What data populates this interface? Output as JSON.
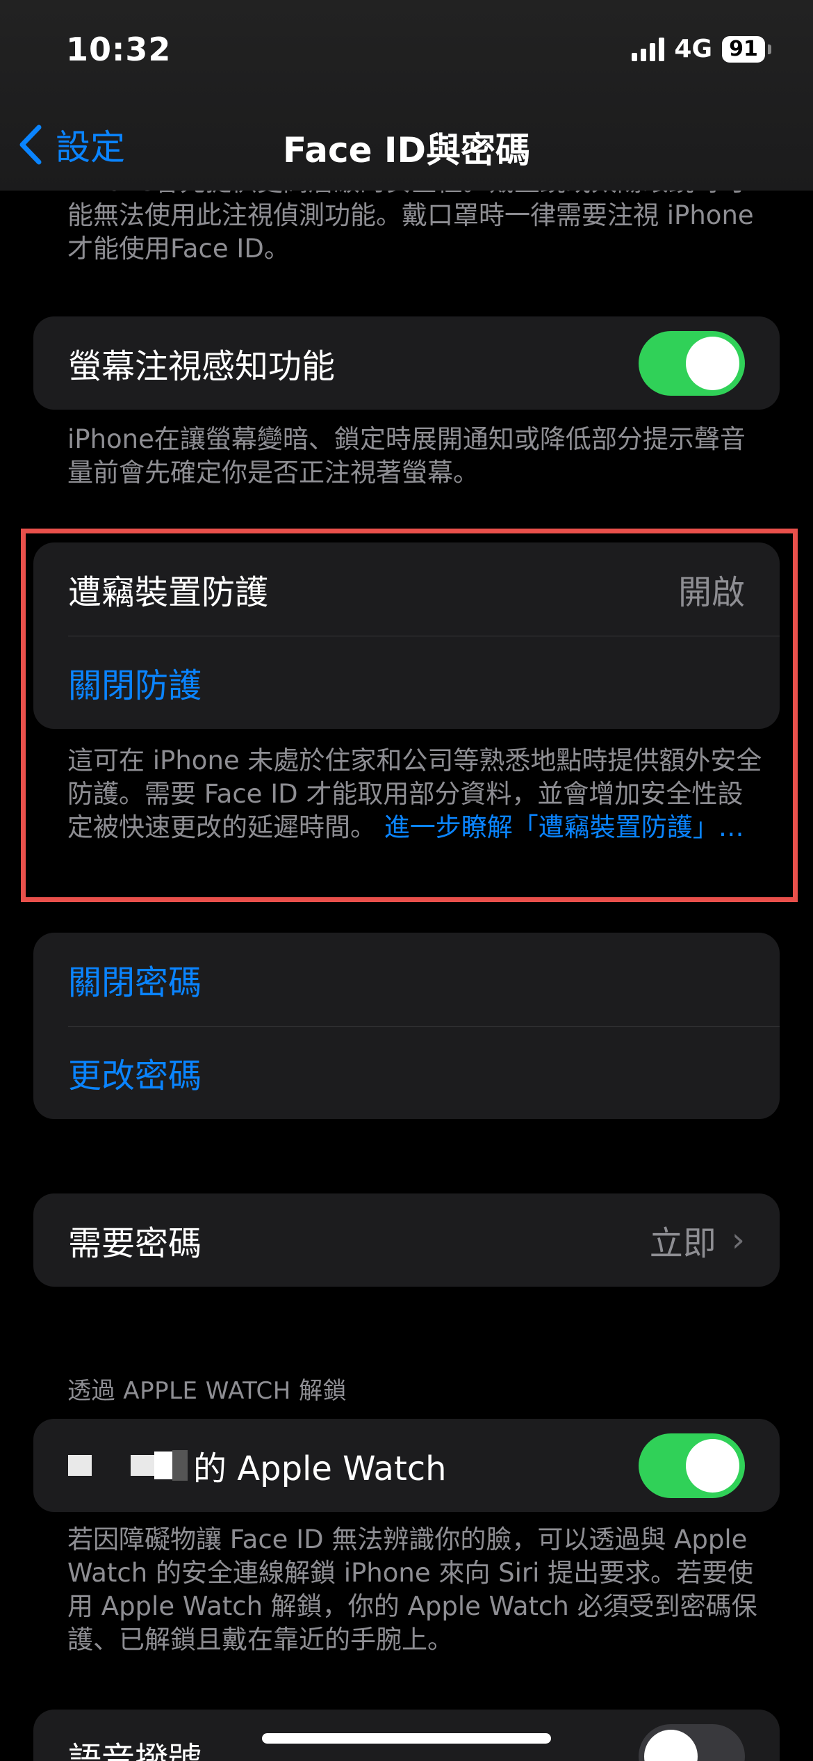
{
  "status_bar": {
    "time": "10:32",
    "network": "4G",
    "battery": "91"
  },
  "nav": {
    "back_label": "設定",
    "title": "Face ID與密碼"
  },
  "top_partial_footnote": "iPhone會先提供更高層級的安全性。戴墨鏡或太陽眼鏡時可能無法使用此注視偵測功能。戴口罩時一律需要注視 iPhone才能使用Face ID。",
  "attention_aware": {
    "label": "螢幕注視感知功能",
    "enabled": true,
    "footnote": "iPhone在讓螢幕變暗、鎖定時展開通知或降低部分提示聲音量前會先確定你是否正注視著螢幕。"
  },
  "stolen_device": {
    "label": "遭竊裝置防護",
    "value": "開啟",
    "action": "關閉防護",
    "footnote": "這可在 iPhone 未處於住家和公司等熟悉地點時提供額外安全防護。需要 Face ID 才能取用部分資料，並會增加安全性設定被快速更改的延遲時間。",
    "learn_more": "進一步瞭解「遭竊裝置防護」…"
  },
  "passcode": {
    "turn_off": "關閉密碼",
    "change": "更改密碼"
  },
  "require_passcode": {
    "label": "需要密碼",
    "value": "立即"
  },
  "apple_watch": {
    "section_header": "透過 APPLE WATCH 解鎖",
    "device_suffix": "的 Apple Watch",
    "enabled": true,
    "footnote": "若因障礙物讓 Face ID 無法辨識你的臉，可以透過與 Apple Watch 的安全連線解鎖 iPhone 來向 Siri 提出要求。若要使用 Apple Watch 解鎖，你的 Apple Watch 必須受到密碼保護、已解鎖且戴在靠近的手腕上。"
  },
  "voice_dial": {
    "label": "語音撥號",
    "enabled": false
  },
  "colors": {
    "accent": "#0a84ff",
    "toggle_on": "#30d158",
    "highlight": "#e9504b"
  }
}
